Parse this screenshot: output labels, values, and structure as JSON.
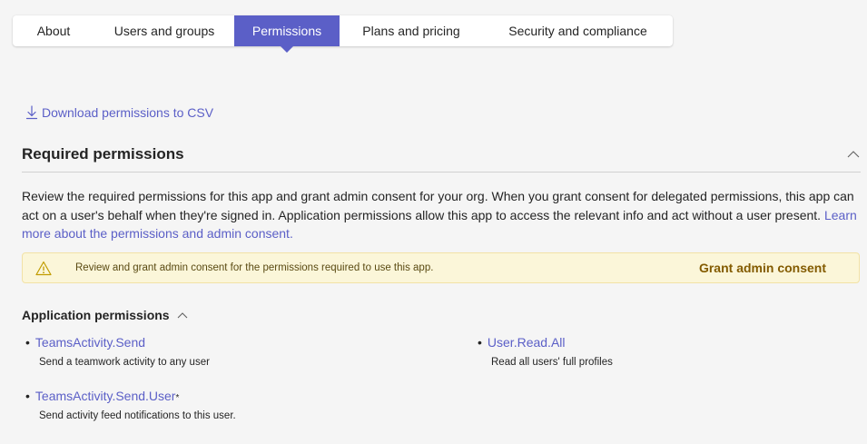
{
  "tabs": [
    {
      "label": "About",
      "active": false
    },
    {
      "label": "Users and groups",
      "active": false
    },
    {
      "label": "Permissions",
      "active": true
    },
    {
      "label": "Plans and pricing",
      "active": false
    },
    {
      "label": "Security and compliance",
      "active": false
    }
  ],
  "download": {
    "label": "Download permissions to CSV"
  },
  "required": {
    "title": "Required permissions",
    "description": "Review the required permissions for this app and grant admin consent for your org. When you grant consent for delegated permissions, this app can act on a user's behalf when they're signed in. Application permissions allow this app to access the relevant info and act without a user present.",
    "learn_more": "Learn more about the permissions and admin consent."
  },
  "banner": {
    "message": "Review and grant admin consent for the permissions required to use this app.",
    "action": "Grant admin consent"
  },
  "application_permissions": {
    "title": "Application permissions",
    "items": [
      {
        "name": "TeamsActivity.Send",
        "description": "Send a teamwork activity to any user",
        "marker": ""
      },
      {
        "name": "User.Read.All",
        "description": "Read all users' full profiles",
        "marker": ""
      },
      {
        "name": "TeamsActivity.Send.User",
        "description": "Send activity feed notifications to this user.",
        "marker": "*"
      }
    ]
  },
  "colors": {
    "accent": "#5b5fc7",
    "warning_bg": "#fbf6d9",
    "warning_text": "#835b00",
    "background": "#f5f5f5"
  }
}
